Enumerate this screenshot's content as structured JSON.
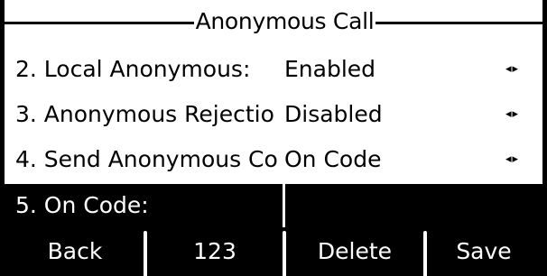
{
  "screen": {
    "title": "Anonymous Call"
  },
  "menu": {
    "items": [
      {
        "label": "2. Local Anonymous:",
        "value": "Enabled",
        "arrows": "◂▸"
      },
      {
        "label": "3. Anonymous Rejectio",
        "value": "Disabled",
        "arrows": "◂▸"
      },
      {
        "label": "4. Send Anonymous Co",
        "value": "On Code",
        "arrows": "◂▸"
      },
      {
        "label": "5. On Code:",
        "value": ""
      }
    ],
    "selected_index": 3
  },
  "softkeys": {
    "back": "Back",
    "input_mode": "123",
    "delete": "Delete",
    "save": "Save"
  },
  "colors": {
    "background": "#ffffff",
    "foreground": "#000000",
    "highlight_bg": "#000000",
    "highlight_fg": "#ffffff"
  }
}
